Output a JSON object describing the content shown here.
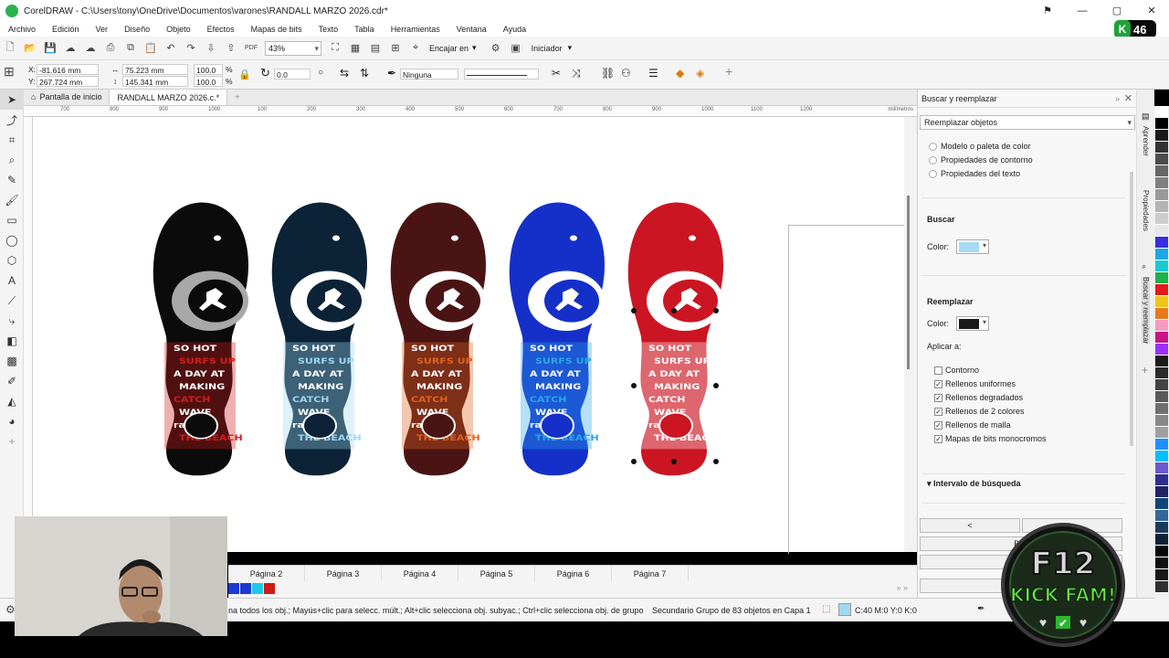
{
  "titlebar": {
    "title": "CorelDRAW - C:\\Users\\tony\\OneDrive\\Documentos\\varones\\RANDALL MARZO 2026.cdr*",
    "minimize": "—",
    "maximize": "▢",
    "close": "✕",
    "bell": "⚑"
  },
  "badge": {
    "letter": "K",
    "count": "46"
  },
  "menu": [
    "Archivo",
    "Edición",
    "Ver",
    "Diseño",
    "Objeto",
    "Efectos",
    "Mapas de bits",
    "Texto",
    "Tabla",
    "Herramientas",
    "Ventana",
    "Ayuda"
  ],
  "toolbar": {
    "zoom": "43%",
    "snap": "Encajar en",
    "workspace": "Iniciador",
    "pdf": "PDF"
  },
  "propbar": {
    "x_label": "X:",
    "x": "-81.616 mm",
    "y_label": "Y:",
    "y": "267.724 mm",
    "w": "75.223 mm",
    "h": "145.341 mm",
    "sx": "100.0",
    "sy": "100.0",
    "pct": "%",
    "rotation": "0.0",
    "outline": "Ninguna"
  },
  "doctabs": {
    "home": "Pantalla de inicio",
    "file": "RANDALL MARZO 2026.c.*"
  },
  "ruler_ticks": [
    "700",
    "800",
    "900",
    "1000",
    "100",
    "200",
    "300",
    "400",
    "500",
    "600",
    "700",
    "800",
    "900",
    "1000",
    "1100",
    "1200"
  ],
  "ruler_unit": "milímetros",
  "pages": [
    "Página 2",
    "Página 3",
    "Página 4",
    "Página 5",
    "Página 6",
    "Página 7"
  ],
  "status": {
    "hint": "na todos los obj.; Mayús+clic para selecc. múlt.; Alt+clic selecciona obj. subyac.; Ctrl+clic selecciona obj. de grupo",
    "selection": "Secundario Grupo de 83 objetos en Capa 1",
    "fill": "C:40 M:0 Y:0 K:0"
  },
  "panel": {
    "title": "Buscar y reemplazar",
    "mode": "Reemplazar objetos",
    "options": [
      "Modelo o paleta de color",
      "Propiedades de contorno",
      "Propiedades del texto"
    ],
    "find_title": "Buscar",
    "find_color_label": "Color:",
    "find_color": "#a8daf5",
    "replace_title": "Reemplazar",
    "replace_color_label": "Color:",
    "replace_color": "#1b1b1b",
    "apply_label": "Aplicar a:",
    "apply": [
      {
        "label": "Contorno",
        "checked": false
      },
      {
        "label": "Rellenos uniformes",
        "checked": true
      },
      {
        "label": "Rellenos degradados",
        "checked": true
      },
      {
        "label": "Rellenos de 2 colores",
        "checked": true
      },
      {
        "label": "Rellenos de malla",
        "checked": true
      },
      {
        "label": "Mapas de bits monocromos",
        "checked": true
      }
    ],
    "range": "Intervalo de búsqueda",
    "prev_btn": "<",
    "find_btn": "Bus",
    "replace_btn": "R"
  },
  "sidetabs": [
    "Aprender",
    "Propiedades",
    "Buscar y reemplazar"
  ],
  "palette": [
    "#ffffff",
    "#000000",
    "#1a1a1a",
    "#333333",
    "#4d4d4d",
    "#666666",
    "#808080",
    "#999999",
    "#b3b3b3",
    "#cccccc",
    "#e6e6e6",
    "#3a2ee0",
    "#1ea7e8",
    "#19c9d6",
    "#1ab34a",
    "#e31b1b",
    "#f0c419",
    "#e87a1e",
    "#f49ac1",
    "#c71585",
    "#9b30ff",
    "#1a1a1a",
    "#2b2b2b",
    "#444444",
    "#5a5a5a",
    "#6f6f6f",
    "#888888",
    "#a0a0a0",
    "#1e90ff",
    "#00bfff",
    "#6a5acd",
    "#2f2f8f",
    "#222266",
    "#114477",
    "#336699",
    "#1a3a5a",
    "#0d2236",
    "#080808",
    "#101010",
    "#181818",
    "#303030"
  ],
  "mini_swatches": [
    "#1a3ad1",
    "#1a3ad1",
    "#1ec8e8",
    "#d11a1a"
  ],
  "logo": {
    "line1": "F12",
    "line2": "KICK FAM!"
  },
  "flipflops": [
    {
      "top": "#0b0b0b",
      "wave": "#a8a8a8",
      "sole": "#0b0b0b",
      "accent": "#d51b1b",
      "text": "#ffffff"
    },
    {
      "top": "#0c2236",
      "wave": "#ffffff",
      "sole": "#0c2236",
      "accent": "#9cd6f0",
      "text": "#ffffff"
    },
    {
      "top": "#4a1414",
      "wave": "#ffffff",
      "sole": "#4a1414",
      "accent": "#e0601c",
      "text": "#ffffff"
    },
    {
      "top": "#1530c9",
      "wave": "#ffffff",
      "sole": "#1530c9",
      "accent": "#2aa7e8",
      "text": "#ffffff"
    },
    {
      "top": "#cc1522",
      "wave": "#ffffff",
      "sole": "#cc1522",
      "accent": "#ffffff",
      "text": "#ffffff"
    }
  ],
  "flip_words": [
    "SO HOT",
    "SURFS UP",
    "A DAY AT",
    "MAKING",
    "CATCH",
    "WAVE",
    "randal",
    "THE BEACH"
  ]
}
